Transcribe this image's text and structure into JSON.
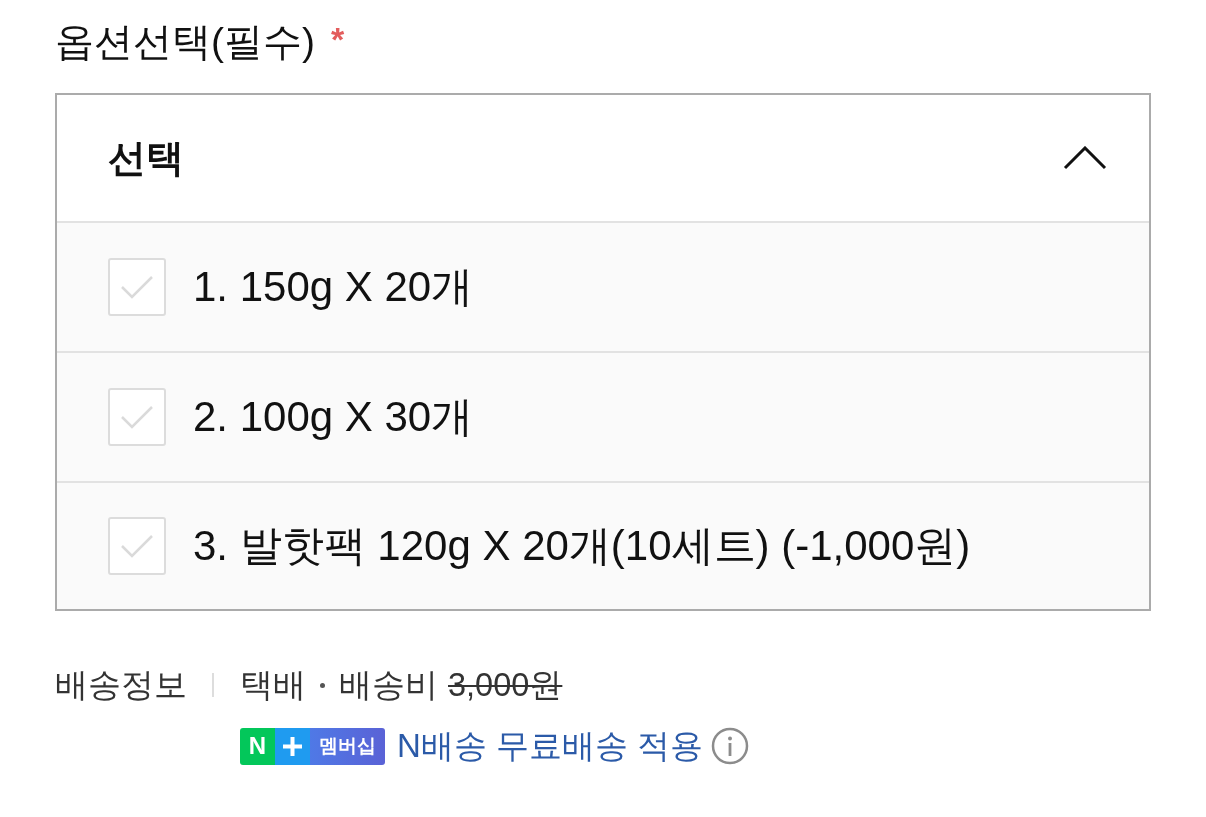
{
  "option_select": {
    "label": "옵션선택(필수)",
    "required_mark": "*",
    "dropdown": {
      "value": "선택",
      "expanded": true,
      "options": [
        {
          "label": "1. 150g X 20개",
          "checked": false
        },
        {
          "label": "2. 100g X 30개",
          "checked": false
        },
        {
          "label": "3. 발핫팩 120g X 20개(10세트) (-1,000원)",
          "checked": false
        }
      ]
    }
  },
  "delivery_info": {
    "label": "배송정보",
    "method": "택배",
    "fee_label": "배송비",
    "original_fee": {
      "text": "3,000원",
      "struck": true
    },
    "membership_badge": {
      "brand": "N",
      "program": "멤버십"
    },
    "benefit": "N배송 무료배송 적용"
  }
}
